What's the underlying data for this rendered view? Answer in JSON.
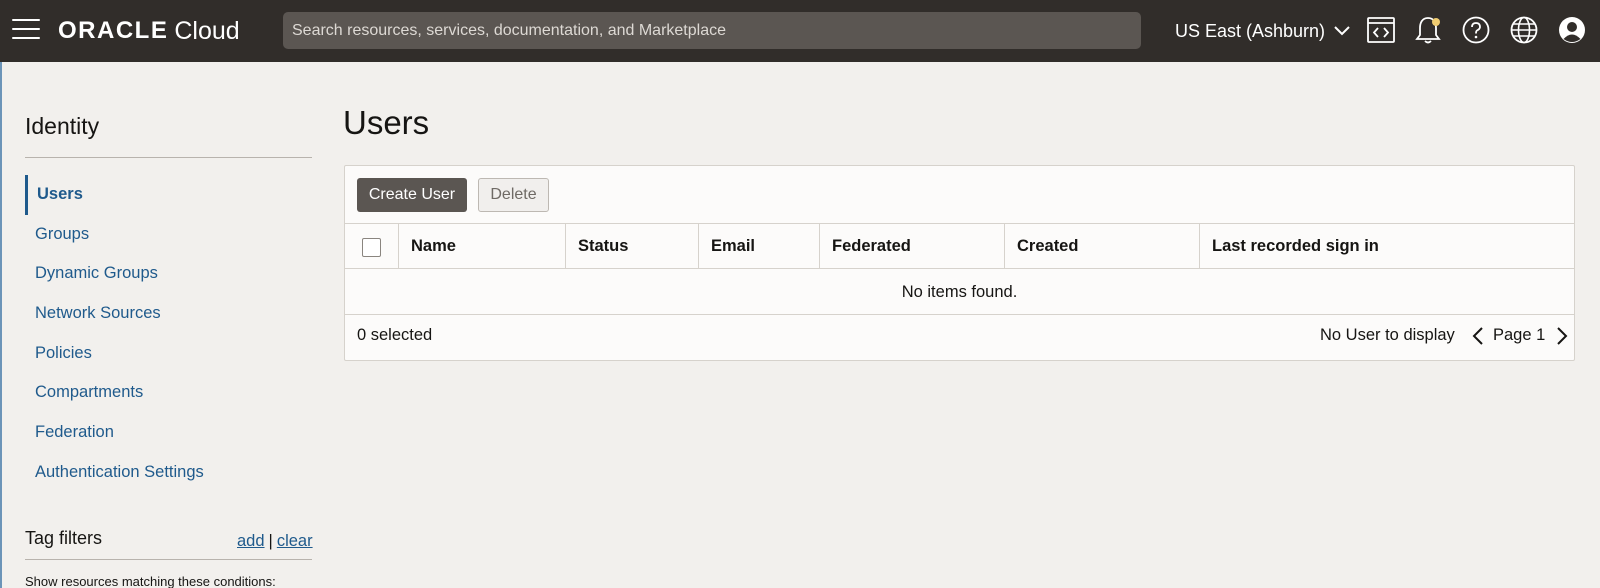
{
  "header": {
    "brand_primary": "ORACLE",
    "brand_secondary": "Cloud",
    "search_placeholder": "Search resources, services, documentation, and Marketplace",
    "region": "US East (Ashburn)",
    "icons": [
      "menu-icon",
      "code-editor-icon",
      "bell-icon",
      "help-icon",
      "globe-icon",
      "user-profile-icon"
    ],
    "notification_dot_color": "#f0cc71"
  },
  "sidebar": {
    "title": "Identity",
    "items": [
      {
        "label": "Users",
        "active": true
      },
      {
        "label": "Groups"
      },
      {
        "label": "Dynamic Groups"
      },
      {
        "label": "Network Sources"
      },
      {
        "label": "Policies"
      },
      {
        "label": "Compartments"
      },
      {
        "label": "Federation"
      },
      {
        "label": "Authentication Settings"
      }
    ],
    "tag_filters": {
      "title": "Tag filters",
      "add_label": "add",
      "separator": "|",
      "clear_label": "clear",
      "note": "Show resources matching these conditions:"
    }
  },
  "main": {
    "title": "Users",
    "toolbar": {
      "create_label": "Create User",
      "delete_label": "Delete"
    },
    "table": {
      "columns": [
        "Name",
        "Status",
        "Email",
        "Federated",
        "Created",
        "Last recorded sign in"
      ],
      "empty_message": "No items found."
    },
    "footer": {
      "selected": "0 selected",
      "display_text": "No User to display",
      "page": "Page 1"
    }
  },
  "colors": {
    "header_bg": "#312d2a",
    "link": "#1f5a8c",
    "primary_button": "#5b5652"
  }
}
